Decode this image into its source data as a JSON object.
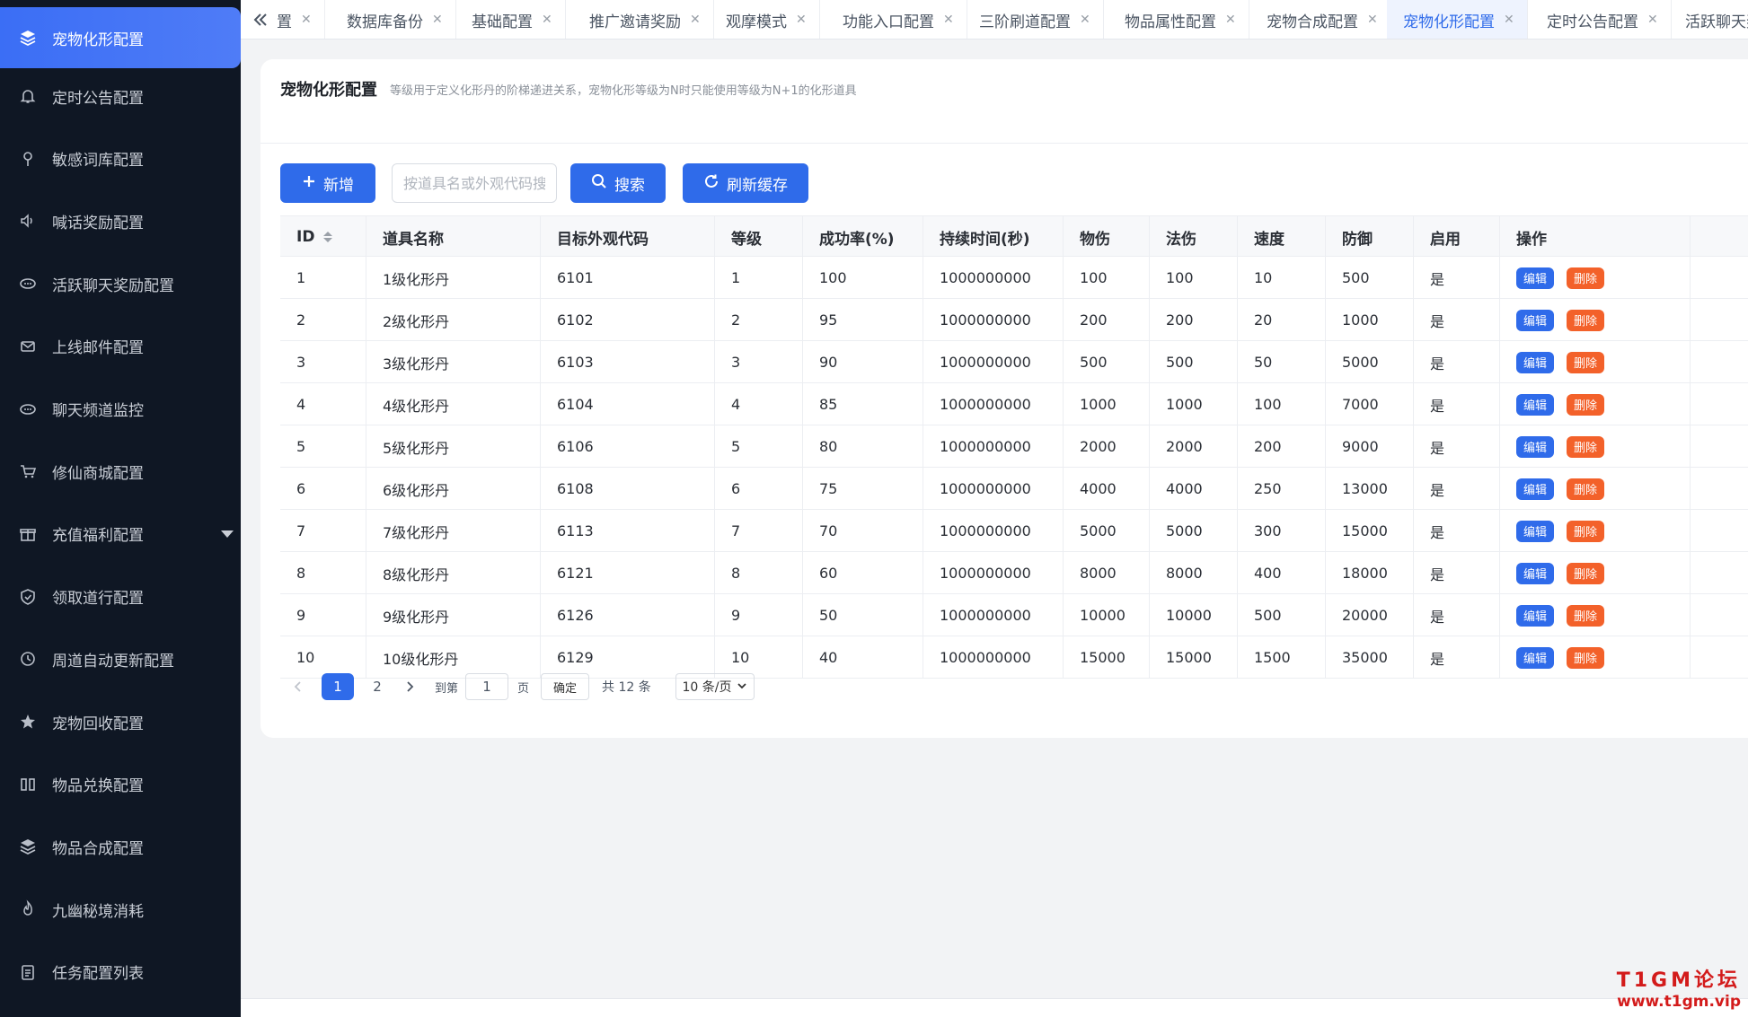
{
  "sidebar": {
    "items": [
      {
        "label": "宠物化形配置",
        "icon": "layers-icon",
        "active": true
      },
      {
        "label": "定时公告配置",
        "icon": "bell-icon"
      },
      {
        "label": "敏感词库配置",
        "icon": "pin-icon"
      },
      {
        "label": "喊话奖励配置",
        "icon": "speaker-icon"
      },
      {
        "label": "活跃聊天奖励配置",
        "icon": "chat-icon"
      },
      {
        "label": "上线邮件配置",
        "icon": "mail-icon"
      },
      {
        "label": "聊天频道监控",
        "icon": "chat-icon"
      },
      {
        "label": "修仙商城配置",
        "icon": "cart-icon"
      },
      {
        "label": "充值福利配置",
        "icon": "gift-icon",
        "has_submenu": true
      },
      {
        "label": "领取道行配置",
        "icon": "shield-icon"
      },
      {
        "label": "周道自动更新配置",
        "icon": "clock-icon"
      },
      {
        "label": "宠物回收配置",
        "icon": "star-icon"
      },
      {
        "label": "物品兑换配置",
        "icon": "columns-icon"
      },
      {
        "label": "物品合成配置",
        "icon": "layers-icon"
      },
      {
        "label": "九幽秘境消耗",
        "icon": "flame-icon"
      },
      {
        "label": "任务配置列表",
        "icon": "list-icon"
      }
    ]
  },
  "tabs": [
    {
      "label": "置"
    },
    {
      "label": "数据库备份"
    },
    {
      "label": "基础配置"
    },
    {
      "label": "推广邀请奖励"
    },
    {
      "label": "观摩模式"
    },
    {
      "label": "功能入口配置"
    },
    {
      "label": "三阶刷道配置"
    },
    {
      "label": "物品属性配置"
    },
    {
      "label": "宠物合成配置"
    },
    {
      "label": "宠物化形配置",
      "active": true
    },
    {
      "label": "定时公告配置"
    },
    {
      "label": "活跃聊天奖"
    }
  ],
  "page": {
    "title": "宠物化形配置",
    "description": "等级用于定义化形丹的阶梯递进关系，宠物化形等级为N时只能使用等级为N+1的化形道具"
  },
  "toolbar": {
    "add_label": "新增",
    "search_placeholder": "按道具名或外观代码搜索",
    "search_label": "搜索",
    "refresh_label": "刷新缓存"
  },
  "table": {
    "columns": [
      "ID",
      "道具名称",
      "目标外观代码",
      "等级",
      "成功率(%)",
      "持续时间(秒)",
      "物伤",
      "法伤",
      "速度",
      "防御",
      "启用",
      "操作"
    ],
    "edit_label": "编辑",
    "delete_label": "删除",
    "rows": [
      [
        "1",
        "1级化形丹",
        "6101",
        "1",
        "100",
        "1000000000",
        "100",
        "100",
        "10",
        "500",
        "是"
      ],
      [
        "2",
        "2级化形丹",
        "6102",
        "2",
        "95",
        "1000000000",
        "200",
        "200",
        "20",
        "1000",
        "是"
      ],
      [
        "3",
        "3级化形丹",
        "6103",
        "3",
        "90",
        "1000000000",
        "500",
        "500",
        "50",
        "5000",
        "是"
      ],
      [
        "4",
        "4级化形丹",
        "6104",
        "4",
        "85",
        "1000000000",
        "1000",
        "1000",
        "100",
        "7000",
        "是"
      ],
      [
        "5",
        "5级化形丹",
        "6106",
        "5",
        "80",
        "1000000000",
        "2000",
        "2000",
        "200",
        "9000",
        "是"
      ],
      [
        "6",
        "6级化形丹",
        "6108",
        "6",
        "75",
        "1000000000",
        "4000",
        "4000",
        "250",
        "13000",
        "是"
      ],
      [
        "7",
        "7级化形丹",
        "6113",
        "7",
        "70",
        "1000000000",
        "5000",
        "5000",
        "300",
        "15000",
        "是"
      ],
      [
        "8",
        "8级化形丹",
        "6121",
        "8",
        "60",
        "1000000000",
        "8000",
        "8000",
        "400",
        "18000",
        "是"
      ],
      [
        "9",
        "9级化形丹",
        "6126",
        "9",
        "50",
        "1000000000",
        "10000",
        "10000",
        "500",
        "20000",
        "是"
      ],
      [
        "10",
        "10级化形丹",
        "6129",
        "10",
        "40",
        "1000000000",
        "15000",
        "15000",
        "1500",
        "35000",
        "是"
      ]
    ]
  },
  "pagination": {
    "pages": [
      "1",
      "2"
    ],
    "current": "1",
    "goto_label": "到第",
    "goto_value": "1",
    "page_suffix": "页",
    "confirm_label": "确定",
    "total_label": "共 12 条",
    "page_size": "10 条/页"
  },
  "watermark": {
    "line1": "T1GM论坛",
    "line2": "www.t1gm.vip"
  },
  "colors": {
    "primary": "#2f6bea",
    "sidebar_bg": "#0f1724",
    "danger": "#f3612a"
  }
}
